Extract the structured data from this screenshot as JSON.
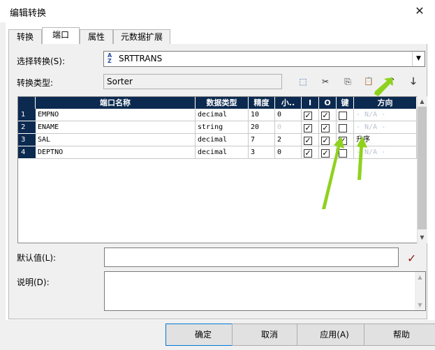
{
  "window": {
    "title": "编辑转换",
    "close_glyph": "✕"
  },
  "tabs": [
    {
      "label": "转换",
      "active": false
    },
    {
      "label": "端口",
      "active": true
    },
    {
      "label": "属性",
      "active": false
    },
    {
      "label": "元数据扩展",
      "active": false
    }
  ],
  "select_transform": {
    "label": "选择转换(S):",
    "value": "SRTTRANS",
    "icon_top": "A",
    "icon_bottom": "Z"
  },
  "transform_type": {
    "label": "转换类型:",
    "value": "Sorter"
  },
  "toolbar": {
    "new": "⬚",
    "cut": "✂",
    "copy": "⎘",
    "paste": "📋",
    "up": "🡑",
    "down": "🡓"
  },
  "grid": {
    "headers": [
      "端口名称",
      "数据类型",
      "精度",
      "小..",
      "I",
      "O",
      "键",
      "方向"
    ],
    "rows": [
      {
        "num": "1",
        "name": "EMPNO",
        "type": "decimal",
        "prec": "10",
        "scale": "0",
        "i": true,
        "o": true,
        "key": false,
        "dir": "- N/A -"
      },
      {
        "num": "2",
        "name": "ENAME",
        "type": "string",
        "prec": "20",
        "scale": "0",
        "i": true,
        "o": true,
        "key": false,
        "dir": "- N/A -"
      },
      {
        "num": "3",
        "name": "SAL",
        "type": "decimal",
        "prec": "7",
        "scale": "2",
        "i": true,
        "o": true,
        "key": true,
        "dir": "升序"
      },
      {
        "num": "4",
        "name": "DEPTNO",
        "type": "decimal",
        "prec": "3",
        "scale": "0",
        "i": true,
        "o": true,
        "key": false,
        "dir": "- N/A -"
      }
    ]
  },
  "default_value": {
    "label": "默认值(L):",
    "value": "",
    "validate_glyph": "✓"
  },
  "description": {
    "label": "说明(D):",
    "value": ""
  },
  "buttons": {
    "ok": "确定",
    "cancel": "取消",
    "apply": "应用(A)",
    "help": "帮助"
  },
  "colors": {
    "grid_header": "#0c2a50",
    "annotation_arrow": "#8fd21e"
  }
}
